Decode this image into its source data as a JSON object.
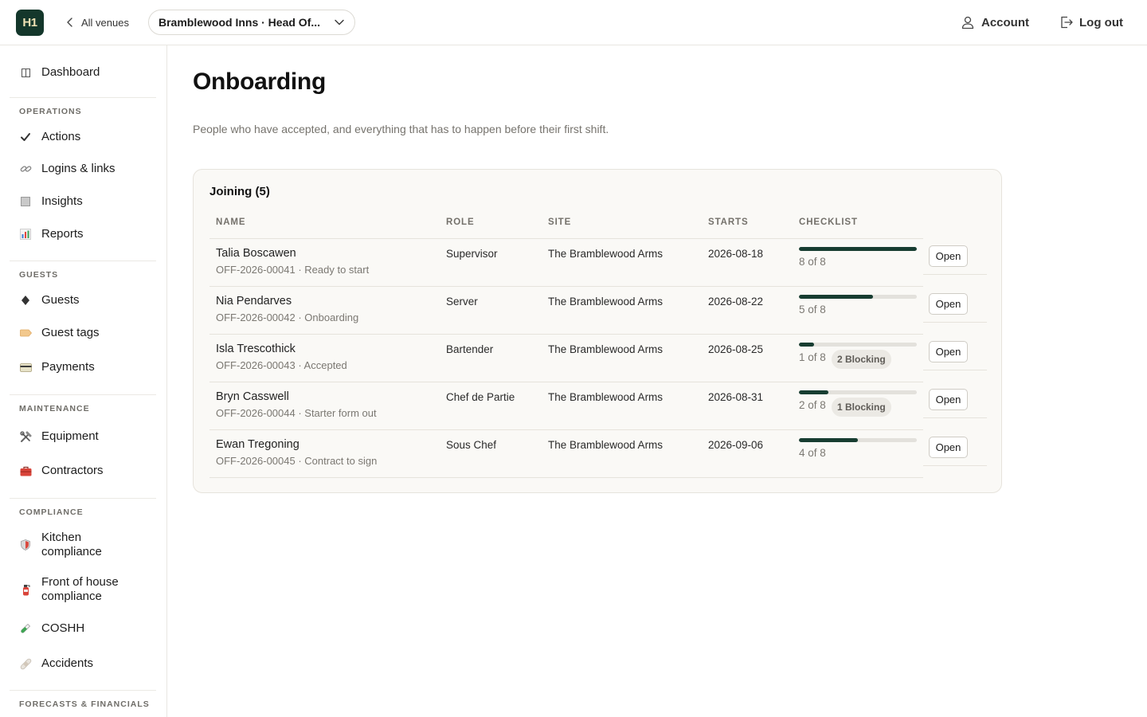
{
  "header": {
    "logo_text": "H1",
    "back_label": "All venues",
    "venue_label": "Bramblewood Inns · Head Of...",
    "account_label": "Account",
    "logout_label": "Log out"
  },
  "sidebar": {
    "dashboard": "Dashboard",
    "sections": {
      "operations": "OPERATIONS",
      "guests": "GUESTS",
      "maintenance": "MAINTENANCE",
      "compliance": "COMPLIANCE",
      "forecasts": "FORECASTS & FINANCIALS"
    },
    "items": {
      "actions": "Actions",
      "logins": "Logins & links",
      "insights": "Insights",
      "reports": "Reports",
      "guests": "Guests",
      "guest_tags": "Guest tags",
      "payments": "Payments",
      "equipment": "Equipment",
      "contractors": "Contractors",
      "kitchen_1": "Kitchen",
      "kitchen_2": "compliance",
      "foh_1": "Front of house",
      "foh_2": "compliance",
      "coshh": "COSHH",
      "accidents": "Accidents"
    }
  },
  "main": {
    "title": "Onboarding",
    "description": "People who have accepted, and everything that has to happen before their first shift.",
    "card_title": "Joining (5)",
    "columns": {
      "name": "NAME",
      "role": "ROLE",
      "site": "SITE",
      "starts": "STARTS",
      "checklist": "CHECKLIST"
    },
    "open_label": "Open",
    "rows": [
      {
        "name": "Talia Boscawen",
        "sub": "OFF-2026-00041 · Ready to start",
        "role": "Supervisor",
        "site": "The Bramblewood Arms",
        "starts": "2026-08-18",
        "done": 8,
        "total": 8,
        "count": "8 of 8",
        "badge": ""
      },
      {
        "name": "Nia Pendarves",
        "sub": "OFF-2026-00042 · Onboarding",
        "role": "Server",
        "site": "The Bramblewood Arms",
        "starts": "2026-08-22",
        "done": 5,
        "total": 8,
        "count": "5 of 8",
        "badge": ""
      },
      {
        "name": "Isla Trescothick",
        "sub": "OFF-2026-00043 · Accepted",
        "role": "Bartender",
        "site": "The Bramblewood Arms",
        "starts": "2026-08-25",
        "done": 1,
        "total": 8,
        "count": "1 of 8",
        "badge": "2 Blocking"
      },
      {
        "name": "Bryn Casswell",
        "sub": "OFF-2026-00044 · Starter form out",
        "role": "Chef de Partie",
        "site": "The Bramblewood Arms",
        "starts": "2026-08-31",
        "done": 2,
        "total": 8,
        "count": "2 of 8",
        "badge": "1 Blocking"
      },
      {
        "name": "Ewan Tregoning",
        "sub": "OFF-2026-00045 · Contract to sign",
        "role": "Sous Chef",
        "site": "The Bramblewood Arms",
        "starts": "2026-09-06",
        "done": 4,
        "total": 8,
        "count": "4 of 8",
        "badge": ""
      }
    ]
  },
  "colors": {
    "brand": "#14372b",
    "progress_fill": "#173d31"
  }
}
